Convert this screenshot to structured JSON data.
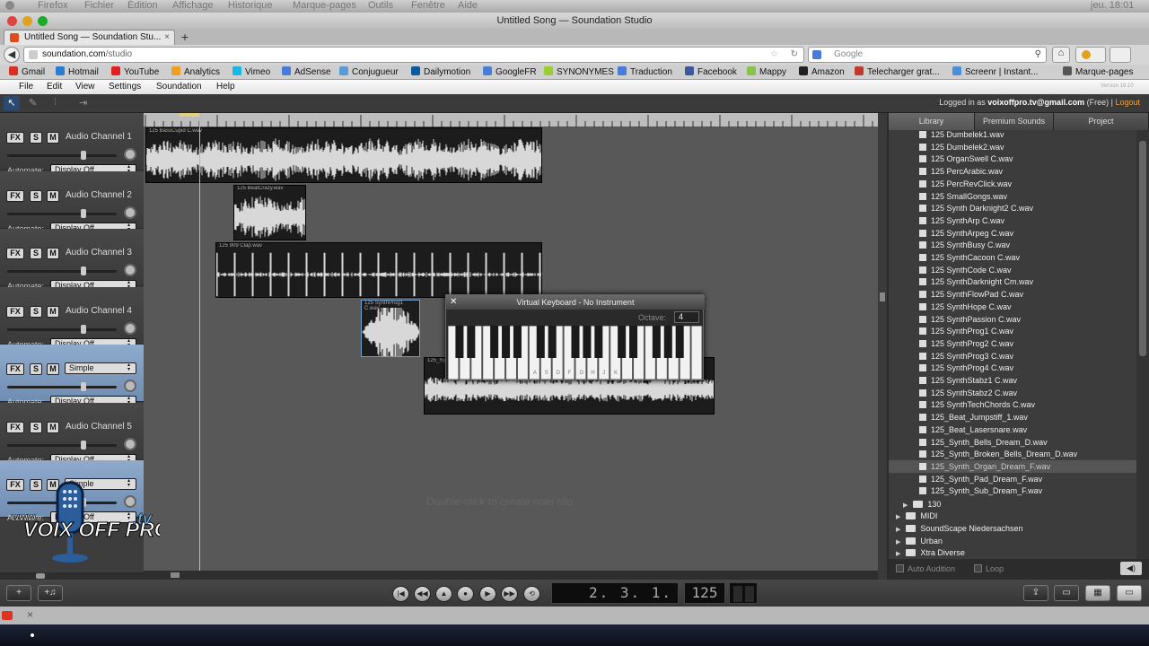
{
  "macbar": {
    "items": [
      "Firefox",
      "Fichier",
      "Édition",
      "Affichage",
      "Historique",
      "Marque-pages",
      "Outils",
      "Fenêtre",
      "Aide"
    ],
    "clock": "jeu. 18:01"
  },
  "window": {
    "title": "Untitled Song — Soundation Studio"
  },
  "browser": {
    "tab": "Untitled Song — Soundation Stu...",
    "url_host": "soundation.com",
    "url_path": "/studio",
    "search_placeholder": "Google"
  },
  "bookmarks": [
    {
      "label": "Gmail",
      "color": "#d93025"
    },
    {
      "label": "Hotmail",
      "color": "#2a7bd1"
    },
    {
      "label": "YouTube",
      "color": "#e02020"
    },
    {
      "label": "Analytics",
      "color": "#f0a020"
    },
    {
      "label": "Vimeo",
      "color": "#1ab7ea"
    },
    {
      "label": "AdSense",
      "color": "#4a7bd6"
    },
    {
      "label": "Conjugueur",
      "color": "#5a9bd6"
    },
    {
      "label": "Dailymotion",
      "color": "#0a5aa0"
    },
    {
      "label": "GoogleFR",
      "color": "#4a7bd6"
    },
    {
      "label": "SYNONYMES",
      "color": "#9acd32"
    },
    {
      "label": "Traduction",
      "color": "#4a7bd6"
    },
    {
      "label": "Facebook",
      "color": "#3b5998"
    },
    {
      "label": "Mappy",
      "color": "#8bc34a"
    },
    {
      "label": "Amazon",
      "color": "#222222"
    },
    {
      "label": "Telecharger grat...",
      "color": "#c0392b"
    },
    {
      "label": "Screenr | Instant...",
      "color": "#4a90d9"
    },
    {
      "label": "Marque-pages",
      "color": "#555555"
    }
  ],
  "appmenu": {
    "items": [
      "File",
      "Edit",
      "View",
      "Settings",
      "Soundation",
      "Help"
    ],
    "version": "Version 18.10"
  },
  "account": {
    "prefix": "Logged in as",
    "email": "voixoffpro.tv@gmail.com",
    "plan": "(Free)",
    "sep": "|",
    "logout": "Logout"
  },
  "channels": [
    {
      "fx": "FX",
      "s": "S",
      "m": "M",
      "name": "Audio Channel 1",
      "automate": "Automate:",
      "display": "Display Off",
      "selected": false
    },
    {
      "fx": "FX",
      "s": "S",
      "m": "M",
      "name": "Audio Channel 2",
      "automate": "Automate:",
      "display": "Display Off",
      "selected": false
    },
    {
      "fx": "FX",
      "s": "S",
      "m": "M",
      "name": "Audio Channel 3",
      "automate": "Automate:",
      "display": "Display Off",
      "selected": false
    },
    {
      "fx": "FX",
      "s": "S",
      "m": "M",
      "name": "Audio Channel 4",
      "automate": "Automate:",
      "display": "Display Off",
      "selected": false
    },
    {
      "fx": "FX",
      "s": "S",
      "m": "M",
      "name": "Simple",
      "automate": "Automate:",
      "display": "Display Off",
      "selected": true
    },
    {
      "fx": "FX",
      "s": "S",
      "m": "M",
      "name": "Audio Channel 5",
      "automate": "Automate:",
      "display": "Display Off",
      "selected": false
    },
    {
      "fx": "FX",
      "s": "S",
      "m": "M",
      "name": "Simple",
      "automate": "Automate:",
      "display": "Display Off",
      "selected": true
    }
  ],
  "clips": [
    {
      "label": "125 BassCupid C.wav"
    },
    {
      "label": "125 BeatCrazy.wav"
    },
    {
      "label": "125 909 Clap.wav"
    },
    {
      "label": "125 SynthProg1 C.wav"
    },
    {
      "label": "125_Synth_Organ_Dream_F.wav"
    }
  ],
  "arrange_hint": "Double-click to create note clip",
  "virtual_keyboard": {
    "title": "Virtual Keyboard - No Instrument",
    "octave_label": "Octave:",
    "octave": "4",
    "key_letters": [
      "A",
      "S",
      "D",
      "F",
      "G",
      "H",
      "J",
      "K"
    ]
  },
  "library": {
    "tabs": [
      "Library",
      "Premium Sounds",
      "Project"
    ],
    "files": [
      "125 Dumbelek1.wav",
      "125 Dumbelek2.wav",
      "125 OrganSwell C.wav",
      "125 PercArabic.wav",
      "125 PercRevClick.wav",
      "125 SmallGongs.wav",
      "125 Synth Darknight2 C.wav",
      "125 SynthArp C.wav",
      "125 SynthArpeg C.wav",
      "125 SynthBusy  C.wav",
      "125 SynthCacoon C.wav",
      "125 SynthCode C.wav",
      "125 SynthDarknight Cm.wav",
      "125 SynthFlowPad C.wav",
      "125 SynthHope C.wav",
      "125 SynthPassion C.wav",
      "125 SynthProg1 C.wav",
      "125 SynthProg2 C.wav",
      "125 SynthProg3 C.wav",
      "125 SynthProg4 C.wav",
      "125 SynthStabz1 C.wav",
      "125 SynthStabz2 C.wav",
      "125 SynthTechChords C.wav",
      "125_Beat_Jumpstiff_1.wav",
      "125_Beat_Lasersnare.wav",
      "125_Synth_Bells_Dream_D.wav",
      "125_Synth_Broken_Bells_Dream_D.wav",
      "125_Synth_Organ_Dream_F.wav",
      "125_Synth_Pad_Dream_F.wav",
      "125_Synth_Sub_Dream_F.wav"
    ],
    "highlighted": "125_Synth_Organ_Dream_F.wav",
    "subfolder": "130",
    "folders": [
      "MIDI",
      "SoundScape Niedersachsen",
      "Urban",
      "Xtra Diverse"
    ],
    "auto_audition": "Auto Audition",
    "loop": "Loop"
  },
  "transport": {
    "position": "2. 3. 1. 191",
    "bpm": "125"
  },
  "watermark": {
    "text": "VOIX OFF PRO",
    "www": "www.",
    "tv": ".tv"
  }
}
